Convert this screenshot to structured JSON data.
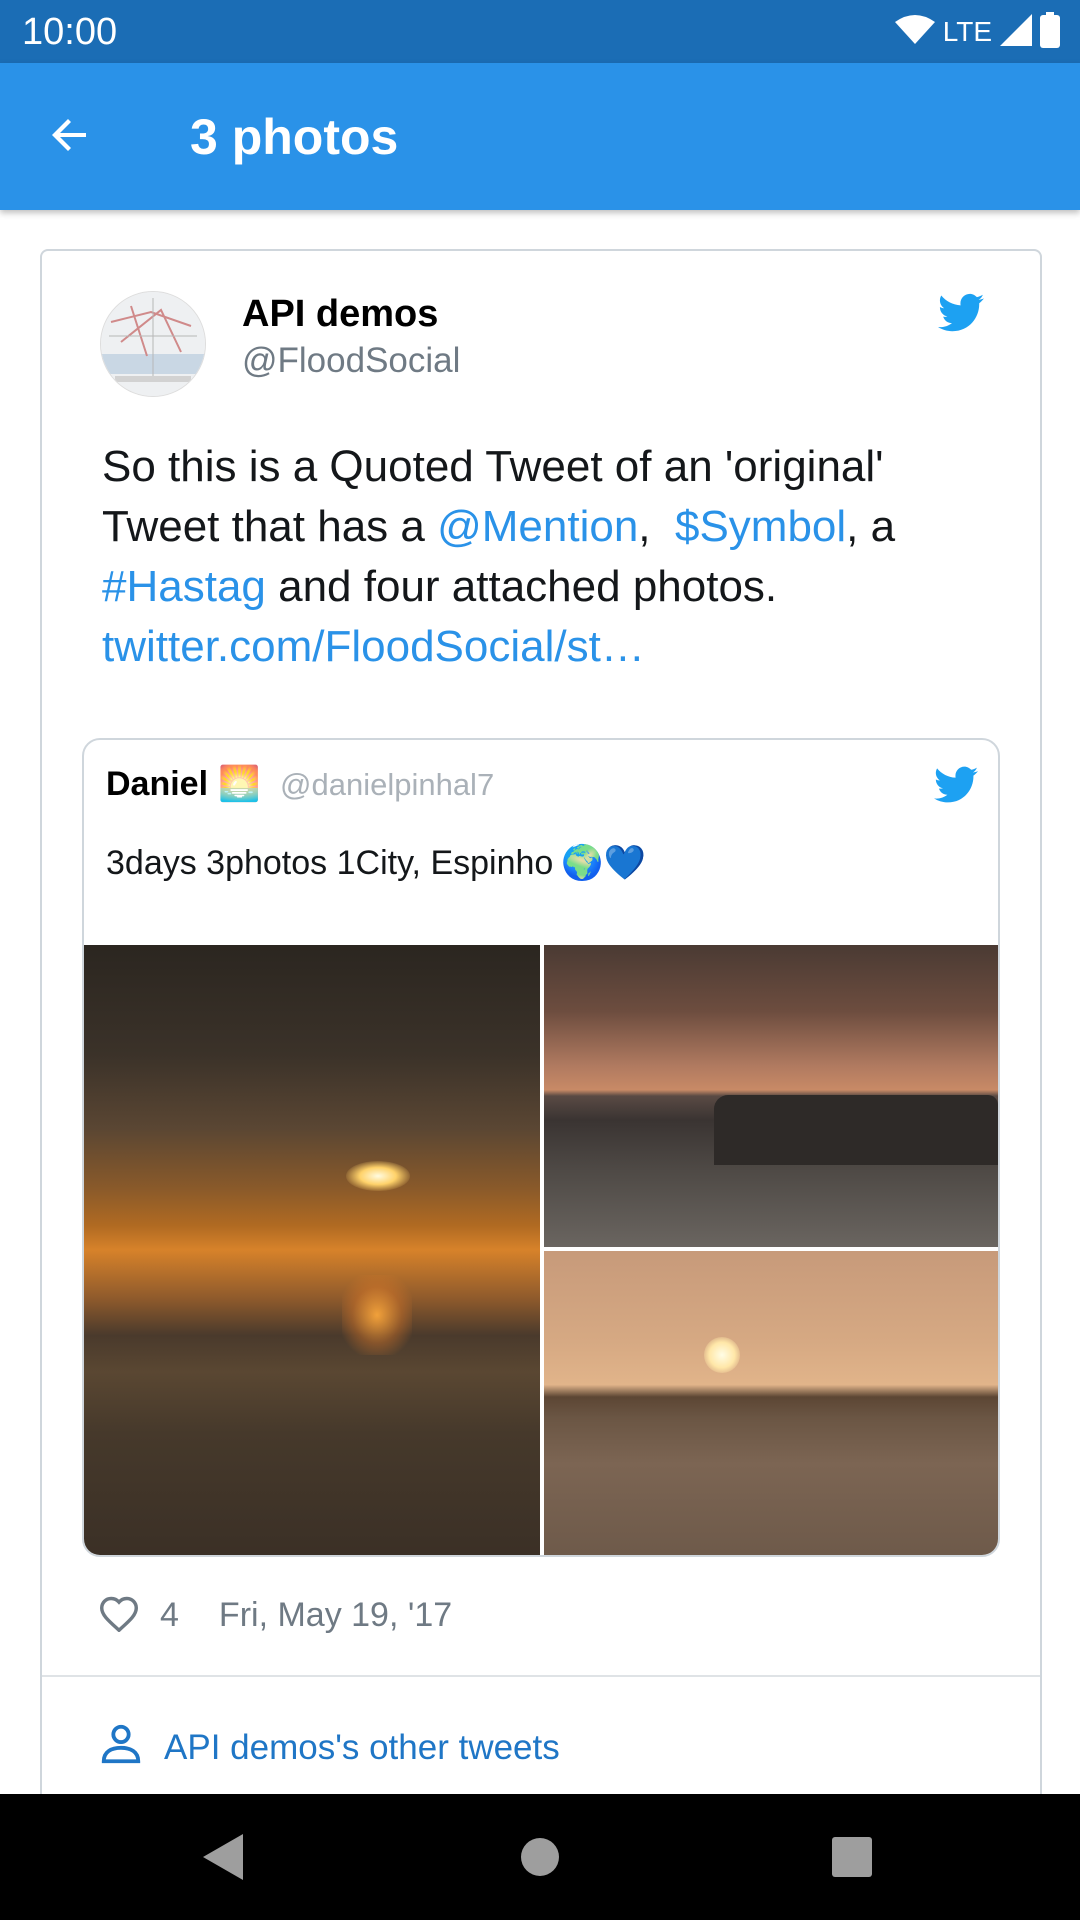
{
  "status_bar": {
    "time": "10:00",
    "network": "LTE",
    "icons": [
      "wifi-icon",
      "signal-icon",
      "battery-icon"
    ]
  },
  "app_bar": {
    "title": "3 photos",
    "back_icon": "arrow-back-icon"
  },
  "tweet": {
    "author_name": "API demos",
    "author_handle": "@FloodSocial",
    "text_parts": {
      "p1": "So this is a Quoted Tweet of an 'original' Tweet that has a ",
      "mention": "@Mention",
      "p2": ",  ",
      "symbol": "$Symbol",
      "p3": ", a ",
      "hashtag": "#Hastag",
      "p4": " and four attached photos. ",
      "link": "twitter.com/FloodSocial/st…"
    },
    "likes": "4",
    "date": "Fri, May 19, '17",
    "other_tweets": "API demos's other tweets"
  },
  "quoted_tweet": {
    "author_name": "Daniel",
    "author_emoji": "🌅",
    "author_handle": "@danielpinhal7",
    "text": "3days 3photos 1City, Espinho",
    "text_emojis": "🌍💙"
  },
  "colors": {
    "status_bar": "#1b6db5",
    "app_bar": "#2a92e8",
    "link": "#2a92e8",
    "twitter_blue": "#1da1f2",
    "secondary_text": "#6f7a84"
  }
}
